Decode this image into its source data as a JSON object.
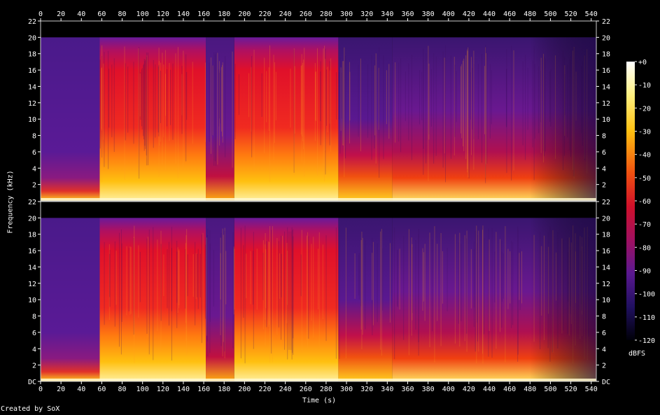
{
  "title": "",
  "credit": "Created by SoX",
  "x_axis": {
    "label": "Time (s)",
    "ticks": [
      "0",
      "20",
      "40",
      "60",
      "80",
      "100",
      "120",
      "140",
      "160",
      "180",
      "200",
      "220",
      "240",
      "260",
      "280",
      "300",
      "320",
      "340",
      "360",
      "380",
      "400",
      "420",
      "440",
      "460",
      "480",
      "500",
      "520",
      "540"
    ]
  },
  "y_axis": {
    "label": "Frequency (kHz)",
    "ticks_top": [
      "2",
      "4",
      "6",
      "8",
      "10",
      "12",
      "14",
      "16",
      "18",
      "20",
      "22"
    ],
    "ticks_bottom": [
      "DC",
      "2",
      "4",
      "6",
      "8",
      "10",
      "12",
      "14",
      "16",
      "18",
      "20",
      "22"
    ]
  },
  "colorbar": {
    "unit": "dBFS",
    "ticks": [
      "+0",
      "-10",
      "-20",
      "-30",
      "-40",
      "-50",
      "-60",
      "-70",
      "-80",
      "-90",
      "-100",
      "-110",
      "-120"
    ]
  },
  "colors": {
    "bg": "#000000",
    "quiet": "#4a1a8a",
    "mid": "#e0102a",
    "loud": "#ffd020",
    "peak": "#ffffe8"
  },
  "chart_data": {
    "type": "heatmap",
    "xlabel": "Time (s)",
    "ylabel": "Frequency (kHz)",
    "xlim": [
      0,
      545
    ],
    "ylim": [
      0,
      22
    ],
    "channels": 2,
    "color_scale_dbfs": [
      -120,
      0
    ],
    "segments_time_s": [
      [
        0,
        58
      ],
      [
        58,
        162
      ],
      [
        162,
        190
      ],
      [
        190,
        292
      ],
      [
        292,
        345
      ],
      [
        345,
        545
      ]
    ],
    "segment_character": [
      "quiet intro",
      "loud",
      "quiet drop",
      "loud",
      "transient section",
      "decaying"
    ]
  }
}
